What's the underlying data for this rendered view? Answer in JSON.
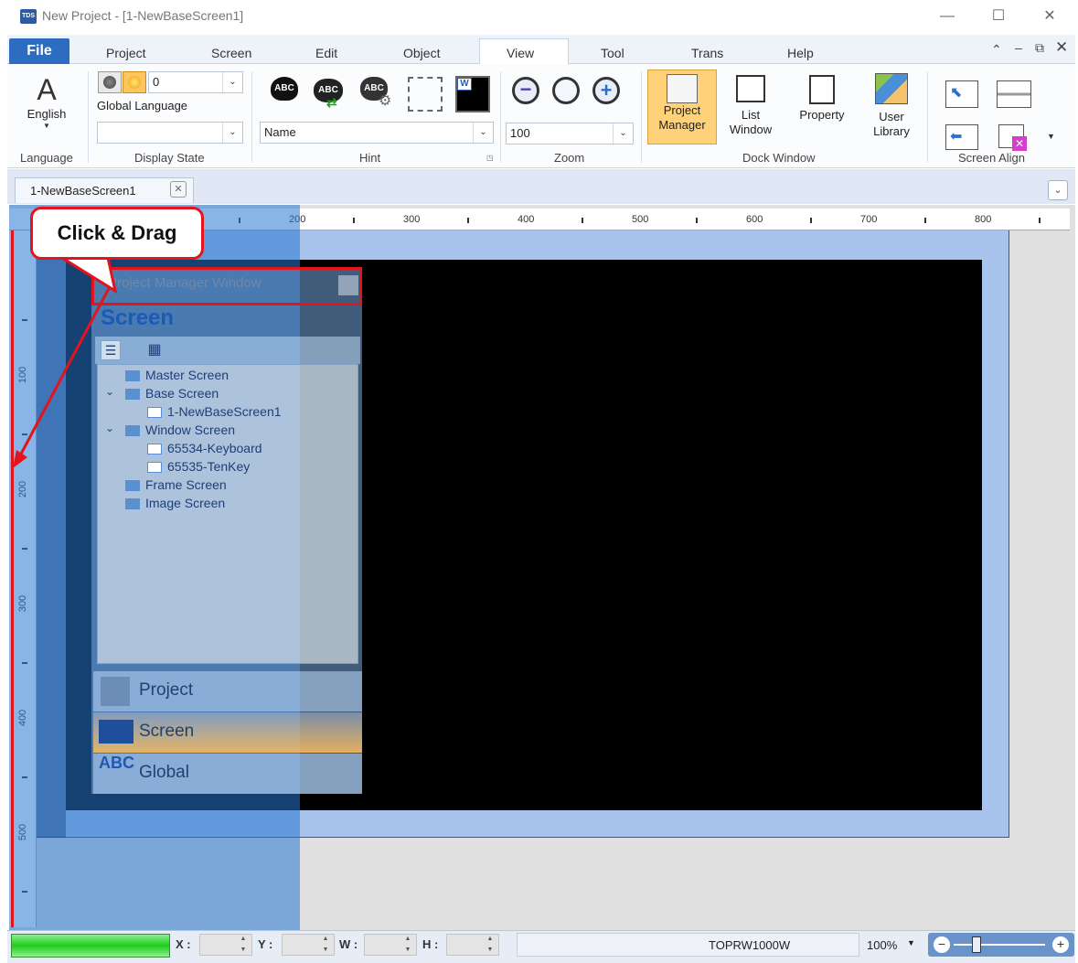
{
  "window": {
    "title": "New Project - [1-NewBaseScreen1]",
    "app_icon": "TDS",
    "controls": [
      "minimize-icon",
      "maximize-icon",
      "close-icon"
    ]
  },
  "ribbon": {
    "file_tab": "File",
    "tabs": [
      "Project",
      "Screen",
      "Edit",
      "Object",
      "View",
      "Tool",
      "Trans",
      "Help"
    ],
    "active_tab": "View",
    "groups": {
      "language": {
        "label": "Language",
        "button_label": "English",
        "icon_glyph": "A"
      },
      "display_state": {
        "label": "Display State",
        "state_value": "0",
        "global_language_label": "Global Language",
        "second_combo_value": ""
      },
      "hint": {
        "label": "Hint",
        "combo_value": "Name",
        "icon_text": "ABC"
      },
      "zoom": {
        "label": "Zoom",
        "combo_value": "100"
      },
      "dock_window": {
        "label": "Dock Window",
        "buttons": [
          {
            "line1": "Project",
            "line2": "Manager"
          },
          {
            "line1": "List",
            "line2": "Window"
          },
          {
            "line1": "Property",
            "line2": ""
          },
          {
            "line1": "User",
            "line2": "Library"
          }
        ]
      },
      "screen_align": {
        "label": "Screen Align"
      }
    }
  },
  "document": {
    "tab_label": "1-NewBaseScreen1"
  },
  "rulers": {
    "horizontal": [
      "200",
      "300",
      "400",
      "500",
      "600",
      "700",
      "800"
    ],
    "vertical": [
      "100",
      "200",
      "300",
      "400",
      "500"
    ]
  },
  "callout": {
    "text": "Click & Drag"
  },
  "project_manager": {
    "title": "Project Manager Window",
    "heading": "Screen",
    "tree": [
      {
        "label": "Master Screen",
        "level": 0
      },
      {
        "label": "Base Screen",
        "level": 0
      },
      {
        "label": "1-NewBaseScreen1",
        "level": 1
      },
      {
        "label": "Window Screen",
        "level": 0
      },
      {
        "label": "65534-Keyboard",
        "level": 1
      },
      {
        "label": "65535-TenKey",
        "level": 1
      },
      {
        "label": "Frame Screen",
        "level": 0
      },
      {
        "label": "Image Screen",
        "level": 0
      }
    ],
    "nav": [
      "Project",
      "Screen",
      "Global"
    ],
    "nav_icon_text": "ABC"
  },
  "statusbar": {
    "x_label": "X :",
    "y_label": "Y :",
    "w_label": "W :",
    "h_label": "H :",
    "model": "TOPRW1000W",
    "zoom": "100%"
  },
  "colors": {
    "accent_red": "#e3141c",
    "file_tab": "#2d6cc0",
    "active_orange": "#ffd27a"
  }
}
